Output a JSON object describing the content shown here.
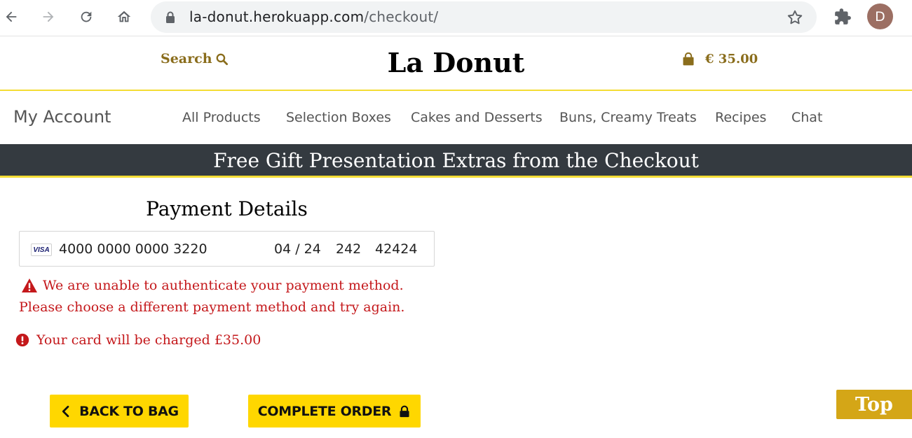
{
  "browser": {
    "url_host": "la-donut.herokuapp.com",
    "url_path": "/checkout/",
    "avatar_letter": "D"
  },
  "header": {
    "search_label": "Search",
    "logo": "La Donut",
    "bag_total": "€ 35.00"
  },
  "nav": {
    "my_account": "My Account",
    "items": [
      {
        "label": "All Products"
      },
      {
        "label": "Selection Boxes"
      },
      {
        "label": "Cakes and Desserts"
      },
      {
        "label": "Buns, Creamy Treats"
      },
      {
        "label": "Recipes"
      },
      {
        "label": "Chat"
      }
    ]
  },
  "banner": {
    "text": "Free Gift Presentation Extras from the Checkout"
  },
  "payment": {
    "title": "Payment Details",
    "card_brand": "VISA",
    "card_number": "4000 0000 0000 3220",
    "expiry": "04 / 24",
    "cvc": "242",
    "postal": "42424",
    "error": "We are unable to authenticate your payment method. Please choose a different payment method and try again.",
    "charge_notice": "Your card will be charged £35.00"
  },
  "buttons": {
    "back": "BACK TO BAG",
    "complete": "COMPLETE ORDER",
    "top": "Top"
  },
  "colors": {
    "accent_yellow": "#ffd700",
    "brand_gold": "#8a6d1c",
    "banner_bg": "#343a40",
    "error_red": "#c4181b"
  }
}
